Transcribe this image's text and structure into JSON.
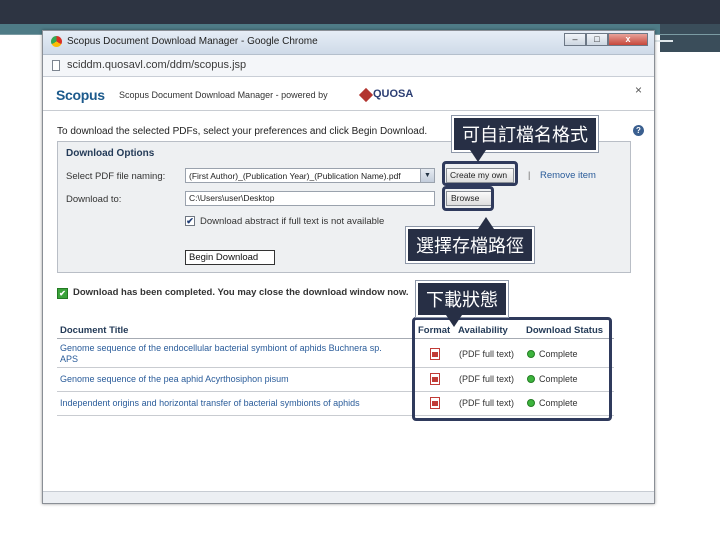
{
  "window": {
    "title": "Scopus Document Download Manager - Google Chrome",
    "url": "sciddm.quosavl.com/ddm/scopus.jsp",
    "buttons": {
      "minimize": "–",
      "maximize": "□",
      "close": "x"
    }
  },
  "header": {
    "logo": "Scopus",
    "subtitle": "Scopus Document Download Manager - powered by",
    "quosa": "QUOSA",
    "close": "×"
  },
  "instructions": "To download the selected PDFs, select your preferences and click Begin Download.",
  "help": "?",
  "options": {
    "title": "Download Options",
    "naming_label": "Select PDF file naming:",
    "naming_value": "(First Author)_(Publication Year)_(Publication Name).pdf",
    "create_button": "Create my own",
    "separator": "|",
    "remove_link": "Remove item",
    "download_to_label": "Download to:",
    "download_path": "C:\\Users\\user\\Desktop",
    "browse_button": "Browse",
    "abstract_checkbox": {
      "checked": true,
      "mark": "✔",
      "label": "Download abstract if full text is not available"
    },
    "begin_button": "Begin Download"
  },
  "status": {
    "icon": "✔",
    "text": "Download has been completed. You may close the download window now."
  },
  "table": {
    "headers": {
      "title": "Document Title",
      "format": "Format",
      "availability": "Availability",
      "status": "Download Status"
    },
    "rows": [
      {
        "title": "Genome sequence of the endocellular bacterial symbiont of aphids Buchnera sp. APS",
        "availability": "(PDF full text)",
        "status": "Complete"
      },
      {
        "title": "Genome sequence of the pea aphid Acyrthosiphon pisum",
        "availability": "(PDF full text)",
        "status": "Complete"
      },
      {
        "title": "Independent origins and horizontal transfer of bacterial symbionts of aphids",
        "availability": "(PDF full text)",
        "status": "Complete"
      }
    ]
  },
  "callouts": {
    "naming": "可自訂檔名格式",
    "path": "選擇存檔路徑",
    "status": "下載狀態"
  },
  "colors": {
    "slide_band": "#2d3442",
    "callout_bg": "#272f45",
    "link": "#2a5c9a",
    "complete": "#3db43d"
  }
}
